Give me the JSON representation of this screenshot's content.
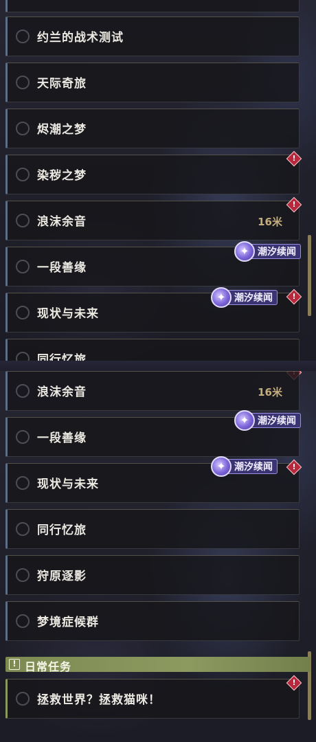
{
  "top_panel": {
    "quests": [
      {
        "title": "约兰的战术测试"
      },
      {
        "title": "天际奇旅"
      },
      {
        "title": "烬潮之梦"
      },
      {
        "title": "染秽之梦"
      },
      {
        "title": "浪沫余音",
        "distance": "16米"
      },
      {
        "title": "一段善缘"
      },
      {
        "title": "现状与未来"
      },
      {
        "title": "同行忆旅"
      }
    ]
  },
  "bottom_panel": {
    "quests": [
      {
        "title": "浪沫余音",
        "distance": "16米"
      },
      {
        "title": "一段善缘"
      },
      {
        "title": "现状与未来"
      },
      {
        "title": "同行忆旅"
      },
      {
        "title": "狩原逐影"
      },
      {
        "title": "梦境症候群"
      }
    ],
    "daily_section": {
      "icon_glyph": "!",
      "title": "日常任务",
      "quests": [
        {
          "title": "拯救世界？拯救猫咪！"
        }
      ]
    }
  },
  "badge_label": "潮汐续闻",
  "alert_glyph": "!",
  "badge_glyph": "✦",
  "colors": {
    "alert": "#b8283c",
    "badge_bg": "#3b3473",
    "distance": "#c6ae7c",
    "daily_accent": "#8a9a5a"
  }
}
